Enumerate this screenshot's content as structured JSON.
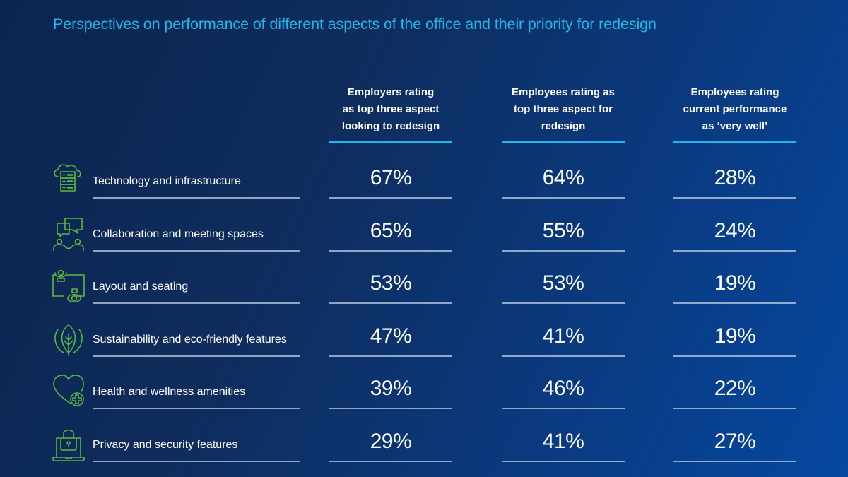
{
  "title": "Perspectives on performance of different aspects of the office and their priority for redesign",
  "colors": {
    "title": "#1fb8ea",
    "header_underline": "#28b4ea",
    "icon": "#5cb83c",
    "text": "#ffffff"
  },
  "columns": [
    "Employers rating as top three aspect looking to redesign",
    "Employees rating as top three aspect for redesign",
    "Employees rating current performance as ‘very well’"
  ],
  "column_header_lines": [
    [
      "Employers rating",
      "as top three aspect",
      "looking to redesign"
    ],
    [
      "Employees rating as",
      "top three aspect for",
      "redesign"
    ],
    [
      "Employees rating",
      "current performance",
      "as ‘very well’"
    ]
  ],
  "rows": [
    {
      "icon": "cloud-server-icon",
      "label": "Technology and infrastructure",
      "values": [
        "67%",
        "64%",
        "28%"
      ]
    },
    {
      "icon": "chat-people-icon",
      "label": "Collaboration and meeting spaces",
      "values": [
        "65%",
        "55%",
        "24%"
      ]
    },
    {
      "icon": "desk-seating-icon",
      "label": "Layout and seating",
      "values": [
        "53%",
        "53%",
        "19%"
      ]
    },
    {
      "icon": "leaf-icon",
      "label": "Sustainability and eco-friendly features",
      "values": [
        "47%",
        "41%",
        "19%"
      ]
    },
    {
      "icon": "heart-plus-icon",
      "label": "Health and wellness amenities",
      "values": [
        "39%",
        "46%",
        "22%"
      ]
    },
    {
      "icon": "laptop-lock-icon",
      "label": "Privacy and security features",
      "values": [
        "29%",
        "41%",
        "27%"
      ]
    }
  ],
  "chart_data": {
    "type": "table",
    "title": "Perspectives on performance of different aspects of the office and their priority for redesign",
    "columns": [
      "Employers rating as top three aspect looking to redesign",
      "Employees rating as top three aspect for redesign",
      "Employees rating current performance as ‘very well’"
    ],
    "categories": [
      "Technology and infrastructure",
      "Collaboration and meeting spaces",
      "Layout and seating",
      "Sustainability and eco-friendly features",
      "Health and wellness amenities",
      "Privacy and security features"
    ],
    "series": [
      {
        "name": "Employers rating as top three aspect looking to redesign",
        "values": [
          67,
          65,
          53,
          47,
          39,
          29
        ]
      },
      {
        "name": "Employees rating as top three aspect for redesign",
        "values": [
          64,
          55,
          53,
          41,
          46,
          41
        ]
      },
      {
        "name": "Employees rating current performance as ‘very well’",
        "values": [
          28,
          24,
          19,
          19,
          22,
          27
        ]
      }
    ],
    "unit": "%"
  }
}
